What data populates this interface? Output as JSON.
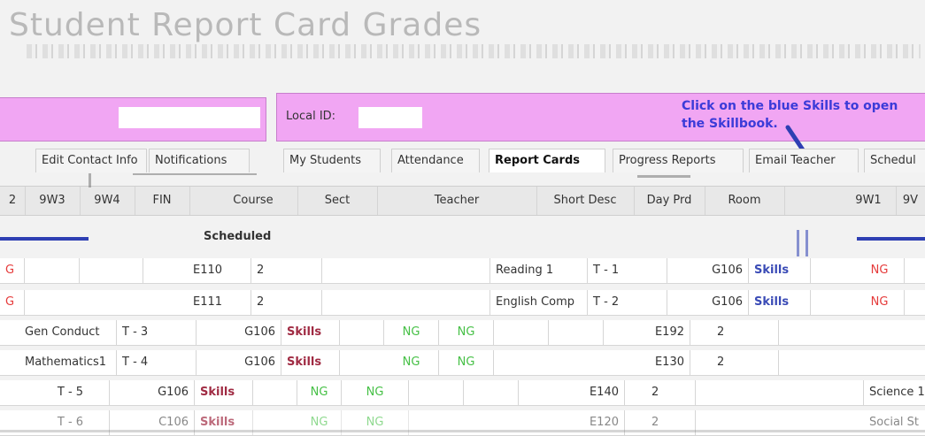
{
  "header": {
    "title": "Student Report Card Grades"
  },
  "panels": {
    "local_id_label": "Local ID:",
    "callout": "Click on the blue Skills to open the Skillbook."
  },
  "tabs": [
    {
      "label": "Edit Contact Info",
      "active": false
    },
    {
      "label": "Notifications",
      "active": false
    },
    {
      "label": "My Students",
      "active": false
    },
    {
      "label": "Attendance",
      "active": false
    },
    {
      "label": "Report Cards",
      "active": true
    },
    {
      "label": "Progress Reports",
      "active": false
    },
    {
      "label": "Email Teacher",
      "active": false
    },
    {
      "label": "Schedul",
      "active": false
    }
  ],
  "table": {
    "headers_left": [
      "2",
      "9W3",
      "9W4",
      "FIN"
    ],
    "headers_right": [
      "Course",
      "Sect",
      "Teacher",
      "Short Desc",
      "Day Prd",
      "Room",
      "9W1",
      "9V"
    ],
    "section_label": "Scheduled",
    "rows": [
      {
        "course": "E110",
        "sect": "2",
        "desc": "Reading 1",
        "dayprd": "T - 1",
        "room": "G106",
        "skills": "Skills",
        "g1": "NG",
        "left": "G"
      },
      {
        "course": "E111",
        "sect": "2",
        "desc": "English Comp",
        "dayprd": "T - 2",
        "room": "G106",
        "skills": "Skills",
        "g1": "NG",
        "left": "G"
      },
      {
        "desc": "Gen Conduct",
        "dayprd": "T - 3",
        "room": "G106",
        "skills": "Skills",
        "g1": "NG",
        "g2": "NG",
        "course": "E192",
        "sect": "2"
      },
      {
        "desc": "Mathematics1",
        "dayprd": "T - 4",
        "room": "G106",
        "skills": "Skills",
        "g1": "NG",
        "g2": "NG",
        "course": "E130",
        "sect": "2"
      },
      {
        "dayprd": "T - 5",
        "room": "G106",
        "skills": "Skills",
        "g1": "NG",
        "g2": "NG",
        "course": "E140",
        "sect": "2",
        "desc_right": "Science 1"
      },
      {
        "dayprd": "T - 6",
        "room": "C106",
        "skills": "Skills",
        "g1": "NG",
        "g2": "NG",
        "course": "E120",
        "sect": "2",
        "desc_right": "Social St"
      }
    ]
  },
  "colors": {
    "panel": "#f1a6f3",
    "accent_blue": "#3b3bd8",
    "ng_red": "#e53b3b",
    "ng_green": "#46c046"
  }
}
